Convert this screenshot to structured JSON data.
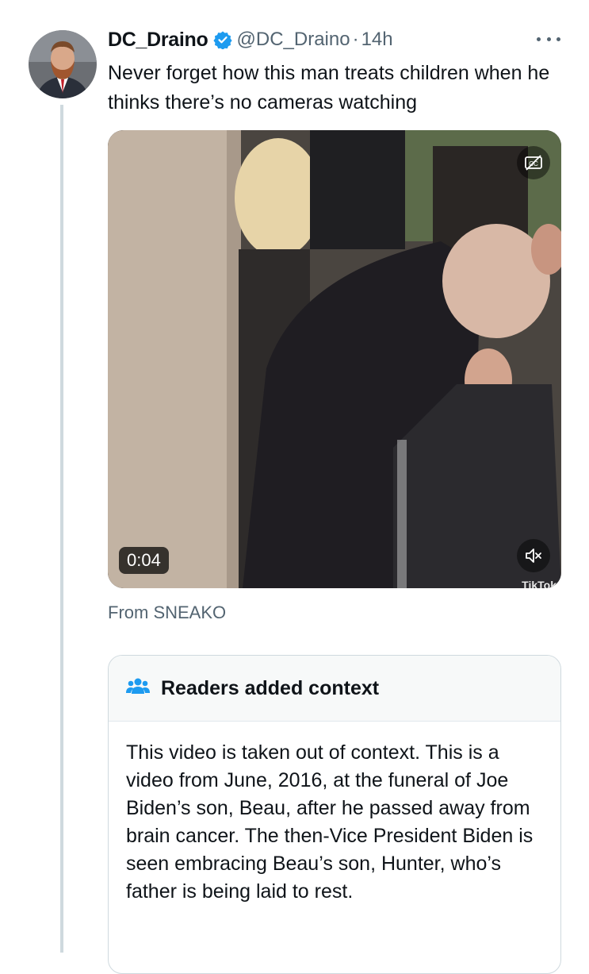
{
  "post": {
    "author_name": "DC_Draino",
    "handle": "@DC_Draino",
    "separator": "·",
    "time": "14h",
    "text": "Never forget how this man treats children when he thinks there’s no cameras watching",
    "verified": true
  },
  "media": {
    "duration": "0:04",
    "watermark": "TikTok",
    "captions_icon": "closed-captions-off-icon",
    "mute_icon": "speaker-muted-icon"
  },
  "source": {
    "label": "From SNEAKO"
  },
  "context_note": {
    "title": "Readers added context",
    "icon": "people-icon",
    "body": "This video is taken out of context. This is a video from June, 2016, at the funeral of Joe Biden’s son, Beau, after he passed away from brain cancer. The then-Vice President Biden is seen embracing Beau’s son, Hunter, who’s father is being laid to rest."
  },
  "colors": {
    "verified": "#1d9bf0",
    "secondary_text": "#536471",
    "thread_line": "#cfd9de",
    "context_header_bg": "#f7f9f9"
  }
}
